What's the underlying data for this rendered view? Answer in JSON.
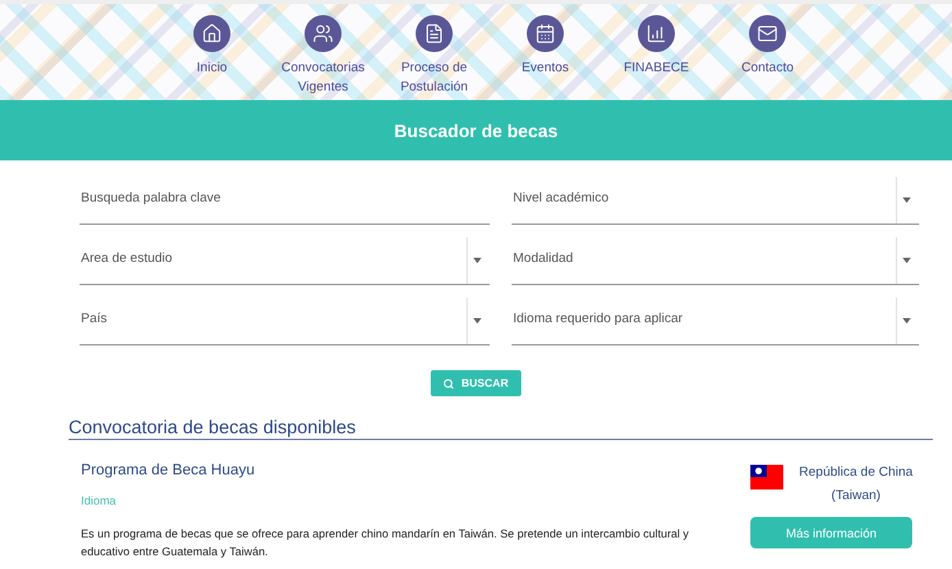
{
  "nav": [
    {
      "lines": [
        "Inicio"
      ]
    },
    {
      "lines": [
        "Convocatorias",
        "Vigentes"
      ]
    },
    {
      "lines": [
        "Proceso de",
        "Postulación"
      ]
    },
    {
      "lines": [
        "Eventos"
      ]
    },
    {
      "lines": [
        "FINABECE"
      ]
    },
    {
      "lines": [
        "Contacto"
      ]
    }
  ],
  "banner": {
    "title": "Buscador de becas"
  },
  "filters": [
    {
      "kind": "text",
      "placeholder": "Busqueda palabra clave"
    },
    {
      "kind": "select",
      "label": "Nivel académico"
    },
    {
      "kind": "select",
      "label": "Area de estudio"
    },
    {
      "kind": "select",
      "label": "Modalidad"
    },
    {
      "kind": "select",
      "label": "País"
    },
    {
      "kind": "select",
      "label": "Idioma requerido para aplicar"
    }
  ],
  "search_button": {
    "label": "BUSCAR"
  },
  "section_title": "Convocatoria de becas disponibles",
  "scholarships": [
    {
      "title": "Programa de Beca Huayu",
      "category": "Idioma",
      "description": "Es un programa de becas que se ofrece para aprender chino mandarín en Taiwán. Se pretende un intercambio cultural y educativo entre Guatemala y Taiwán.",
      "country_lines": [
        "República de China",
        "(Taiwan)"
      ],
      "button": "Más información"
    }
  ]
}
